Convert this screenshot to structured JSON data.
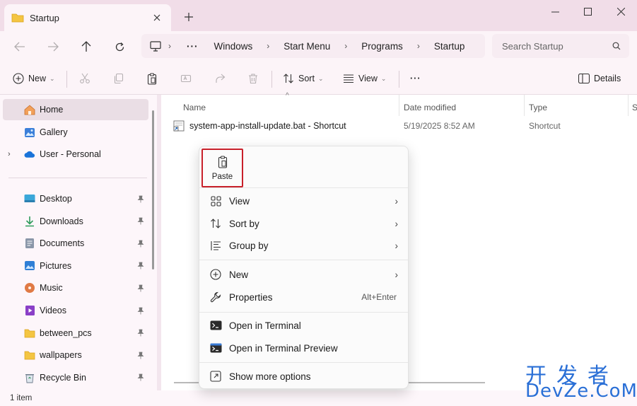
{
  "window": {
    "tab_title": "Startup",
    "new_tab": "+"
  },
  "nav": {
    "breadcrumb_more": "···",
    "breadcrumb": [
      "Windows",
      "Start Menu",
      "Programs",
      "Startup"
    ],
    "search_placeholder": "Search Startup"
  },
  "toolbar": {
    "new_label": "New",
    "sort_label": "Sort",
    "view_label": "View",
    "more_label": "···",
    "details_label": "Details"
  },
  "sidebar": {
    "home": "Home",
    "gallery": "Gallery",
    "onedrive": "User - Personal",
    "pinned": [
      {
        "label": "Desktop",
        "icon": "desktop-icon"
      },
      {
        "label": "Downloads",
        "icon": "downloads-icon"
      },
      {
        "label": "Documents",
        "icon": "documents-icon"
      },
      {
        "label": "Pictures",
        "icon": "pictures-icon"
      },
      {
        "label": "Music",
        "icon": "music-icon"
      },
      {
        "label": "Videos",
        "icon": "videos-icon"
      },
      {
        "label": "between_pcs",
        "icon": "folder-icon"
      },
      {
        "label": "wallpapers",
        "icon": "folder-icon"
      },
      {
        "label": "Recycle Bin",
        "icon": "recycle-bin-icon"
      }
    ]
  },
  "columns": {
    "name": "Name",
    "date": "Date modified",
    "type": "Type",
    "extra": "S"
  },
  "files": [
    {
      "name": "system-app-install-update.bat - Shortcut",
      "date": "5/19/2025 8:52 AM",
      "type": "Shortcut"
    }
  ],
  "status": {
    "count": "1 item"
  },
  "context_menu": {
    "paste_label": "Paste",
    "view": "View",
    "sort_by": "Sort by",
    "group_by": "Group by",
    "new": "New",
    "properties": "Properties",
    "properties_shortcut": "Alt+Enter",
    "open_terminal": "Open in Terminal",
    "open_terminal_preview": "Open in Terminal Preview",
    "show_more": "Show more options"
  },
  "watermark": {
    "line1": "开发者",
    "line2": "DevZe.CoM"
  },
  "colors": {
    "accent_highlight": "#c8202a",
    "chrome": "#f1dde8",
    "watermark": "#2a6fd6"
  }
}
